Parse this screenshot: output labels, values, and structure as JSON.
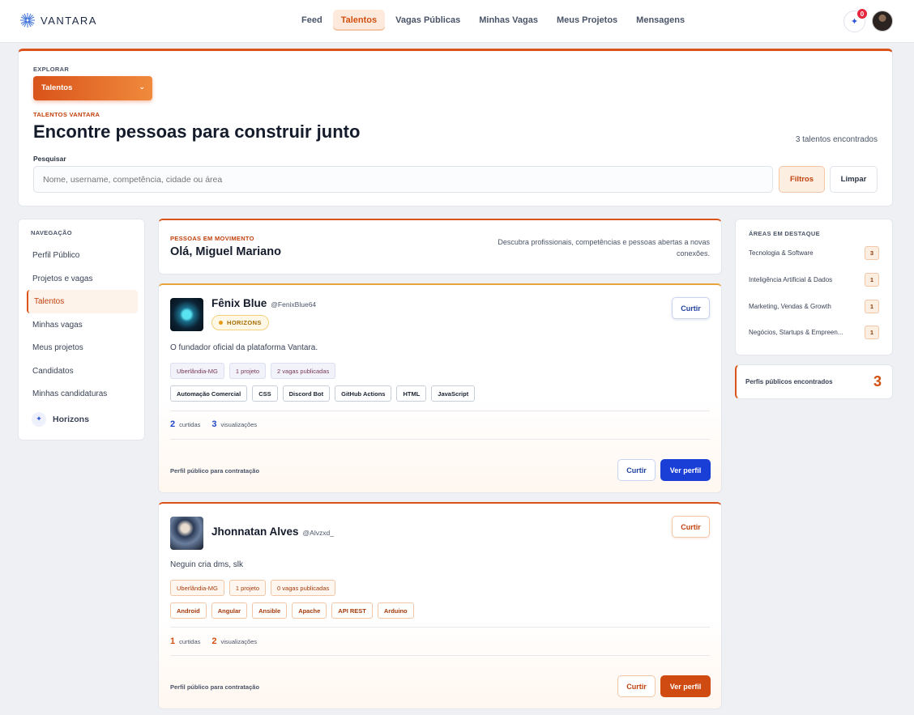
{
  "brand": {
    "name": "VANTARA"
  },
  "nav": {
    "items": [
      "Feed",
      "Talentos",
      "Vagas Públicas",
      "Minhas Vagas",
      "Meus Projetos",
      "Mensagens"
    ],
    "active": "Talentos",
    "notification_count": "0"
  },
  "hero": {
    "explore_label": "EXPLORAR",
    "explore_value": "Talentos",
    "kicker": "TALENTOS VANTARA",
    "title": "Encontre pessoas para construir junto",
    "count_text": "3 talentos encontrados",
    "search_label": "Pesquisar",
    "search_placeholder": "Nome, username, competência, cidade ou área",
    "search_value": "",
    "filters_button": "Filtros",
    "clear_button": "Limpar"
  },
  "sidebar": {
    "heading": "NAVEGAÇÃO",
    "items": [
      "Perfil Público",
      "Projetos e vagas",
      "Talentos",
      "Minhas vagas",
      "Meus projetos",
      "Candidatos",
      "Minhas candidaturas"
    ],
    "active": "Talentos",
    "horizons_label": "Horizons"
  },
  "greeting": {
    "kicker": "PESSOAS EM MOVIMENTO",
    "title": "Olá, Miguel Mariano",
    "description": "Descubra profissionais, competências e pessoas abertas a novas conexões."
  },
  "talents": [
    {
      "name": "Fênix Blue",
      "handle": "@FenixBlue64",
      "badge": "HORIZONS",
      "bio": "O fundador oficial da plataforma Vantara.",
      "meta": [
        "Uberlândia-MG",
        "1 projeto",
        "2 vagas publicadas"
      ],
      "skills": [
        "Automação Comercial",
        "CSS",
        "Discord Bot",
        "GitHub Actions",
        "HTML",
        "JavaScript"
      ],
      "likes": "2",
      "likes_label": "curtidas",
      "views": "3",
      "views_label": "visualizações",
      "footer": "Perfil público para contratação",
      "like_button": "Curtir",
      "view_button": "Ver perfil"
    },
    {
      "name": "Jhonnatan Alves",
      "handle": "@Alvzxd_",
      "bio": "Neguin cria dms, slk",
      "meta": [
        "Uberlândia-MG",
        "1 projeto",
        "0 vagas publicadas"
      ],
      "skills": [
        "Android",
        "Angular",
        "Ansible",
        "Apache",
        "API REST",
        "Arduino"
      ],
      "likes": "1",
      "likes_label": "curtidas",
      "views": "2",
      "views_label": "visualizações",
      "footer": "Perfil público para contratação",
      "like_button": "Curtir",
      "view_button": "Ver perfil"
    }
  ],
  "areas": {
    "heading": "ÁREAS EM DESTAQUE",
    "items": [
      {
        "name": "Tecnologia & Software",
        "count": "3"
      },
      {
        "name": "Inteligência Artificial & Dados",
        "count": "1"
      },
      {
        "name": "Marketing, Vendas & Growth",
        "count": "1"
      },
      {
        "name": "Negócios, Startups & Empreen...",
        "count": "1"
      }
    ]
  },
  "found": {
    "label": "Perfis públicos encontrados",
    "count": "3"
  },
  "colors": {
    "accent": "#d9531a",
    "primary_blue": "#1a3fd6",
    "badge_gold": "#e89a18"
  }
}
